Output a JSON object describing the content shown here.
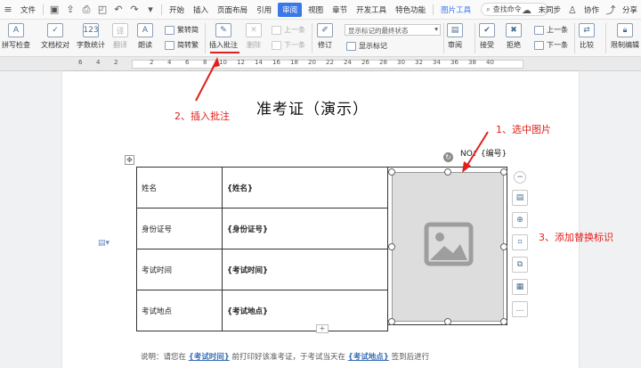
{
  "menu": {
    "file": "文件",
    "tabs": [
      "开始",
      "插入",
      "页面布局",
      "引用",
      "审阅",
      "视图",
      "章节",
      "开发工具",
      "特色功能"
    ],
    "active_tab": "审阅",
    "picture_tools": "图片工具",
    "search_placeholder": "查找命令",
    "unsynced": "未同步",
    "collab": "协作",
    "share": "分享"
  },
  "ribbon": {
    "spell_check": "拼写检查",
    "doc_proof": "文档校对",
    "word_count": "字数统计",
    "translate": "翻译",
    "read_aloud": "朗读",
    "trad_convert": "繁转简",
    "simp_convert": "简转繁",
    "insert_comment": "插入批注",
    "delete": "删除",
    "prev": "上一条",
    "next": "下一条",
    "revise": "修订",
    "markup_state": "显示标记的最终状态",
    "show_markup": "显示标记",
    "review": "审阅",
    "accept": "接受",
    "reject": "拒绝",
    "prev_change": "上一条",
    "next_change": "下一条",
    "compare": "比较",
    "restrict_edit": "限制编辑"
  },
  "ruler": {
    "labels": [
      "6",
      "4",
      "2",
      "2",
      "4",
      "6",
      "8",
      "10",
      "12",
      "14",
      "16",
      "18",
      "20",
      "22",
      "24",
      "26",
      "28",
      "30",
      "32",
      "34",
      "36",
      "38",
      "40"
    ]
  },
  "document": {
    "title": "准考证（演示）",
    "number_label": "NO：{编号}",
    "rows": [
      {
        "label": "姓名",
        "value": "{姓名}"
      },
      {
        "label": "身份证号",
        "value": "{身份证号}"
      },
      {
        "label": "考试时间",
        "value": "{考试时间}"
      },
      {
        "label": "考试地点",
        "value": "{考试地点}"
      }
    ],
    "explain_prefix": "说明：请您在",
    "explain_field1": "{考试时间}",
    "explain_mid": "前打印好该准考证，于考试当天在",
    "explain_field2": "{考试地点}",
    "explain_suffix": "签到后进行"
  },
  "annotations": {
    "step1": "1、选中图片",
    "step2": "2、插入批注",
    "step3": "3、添加替换标识"
  },
  "colors": {
    "accent": "#3b78e7",
    "annotation": "#e0201c"
  }
}
